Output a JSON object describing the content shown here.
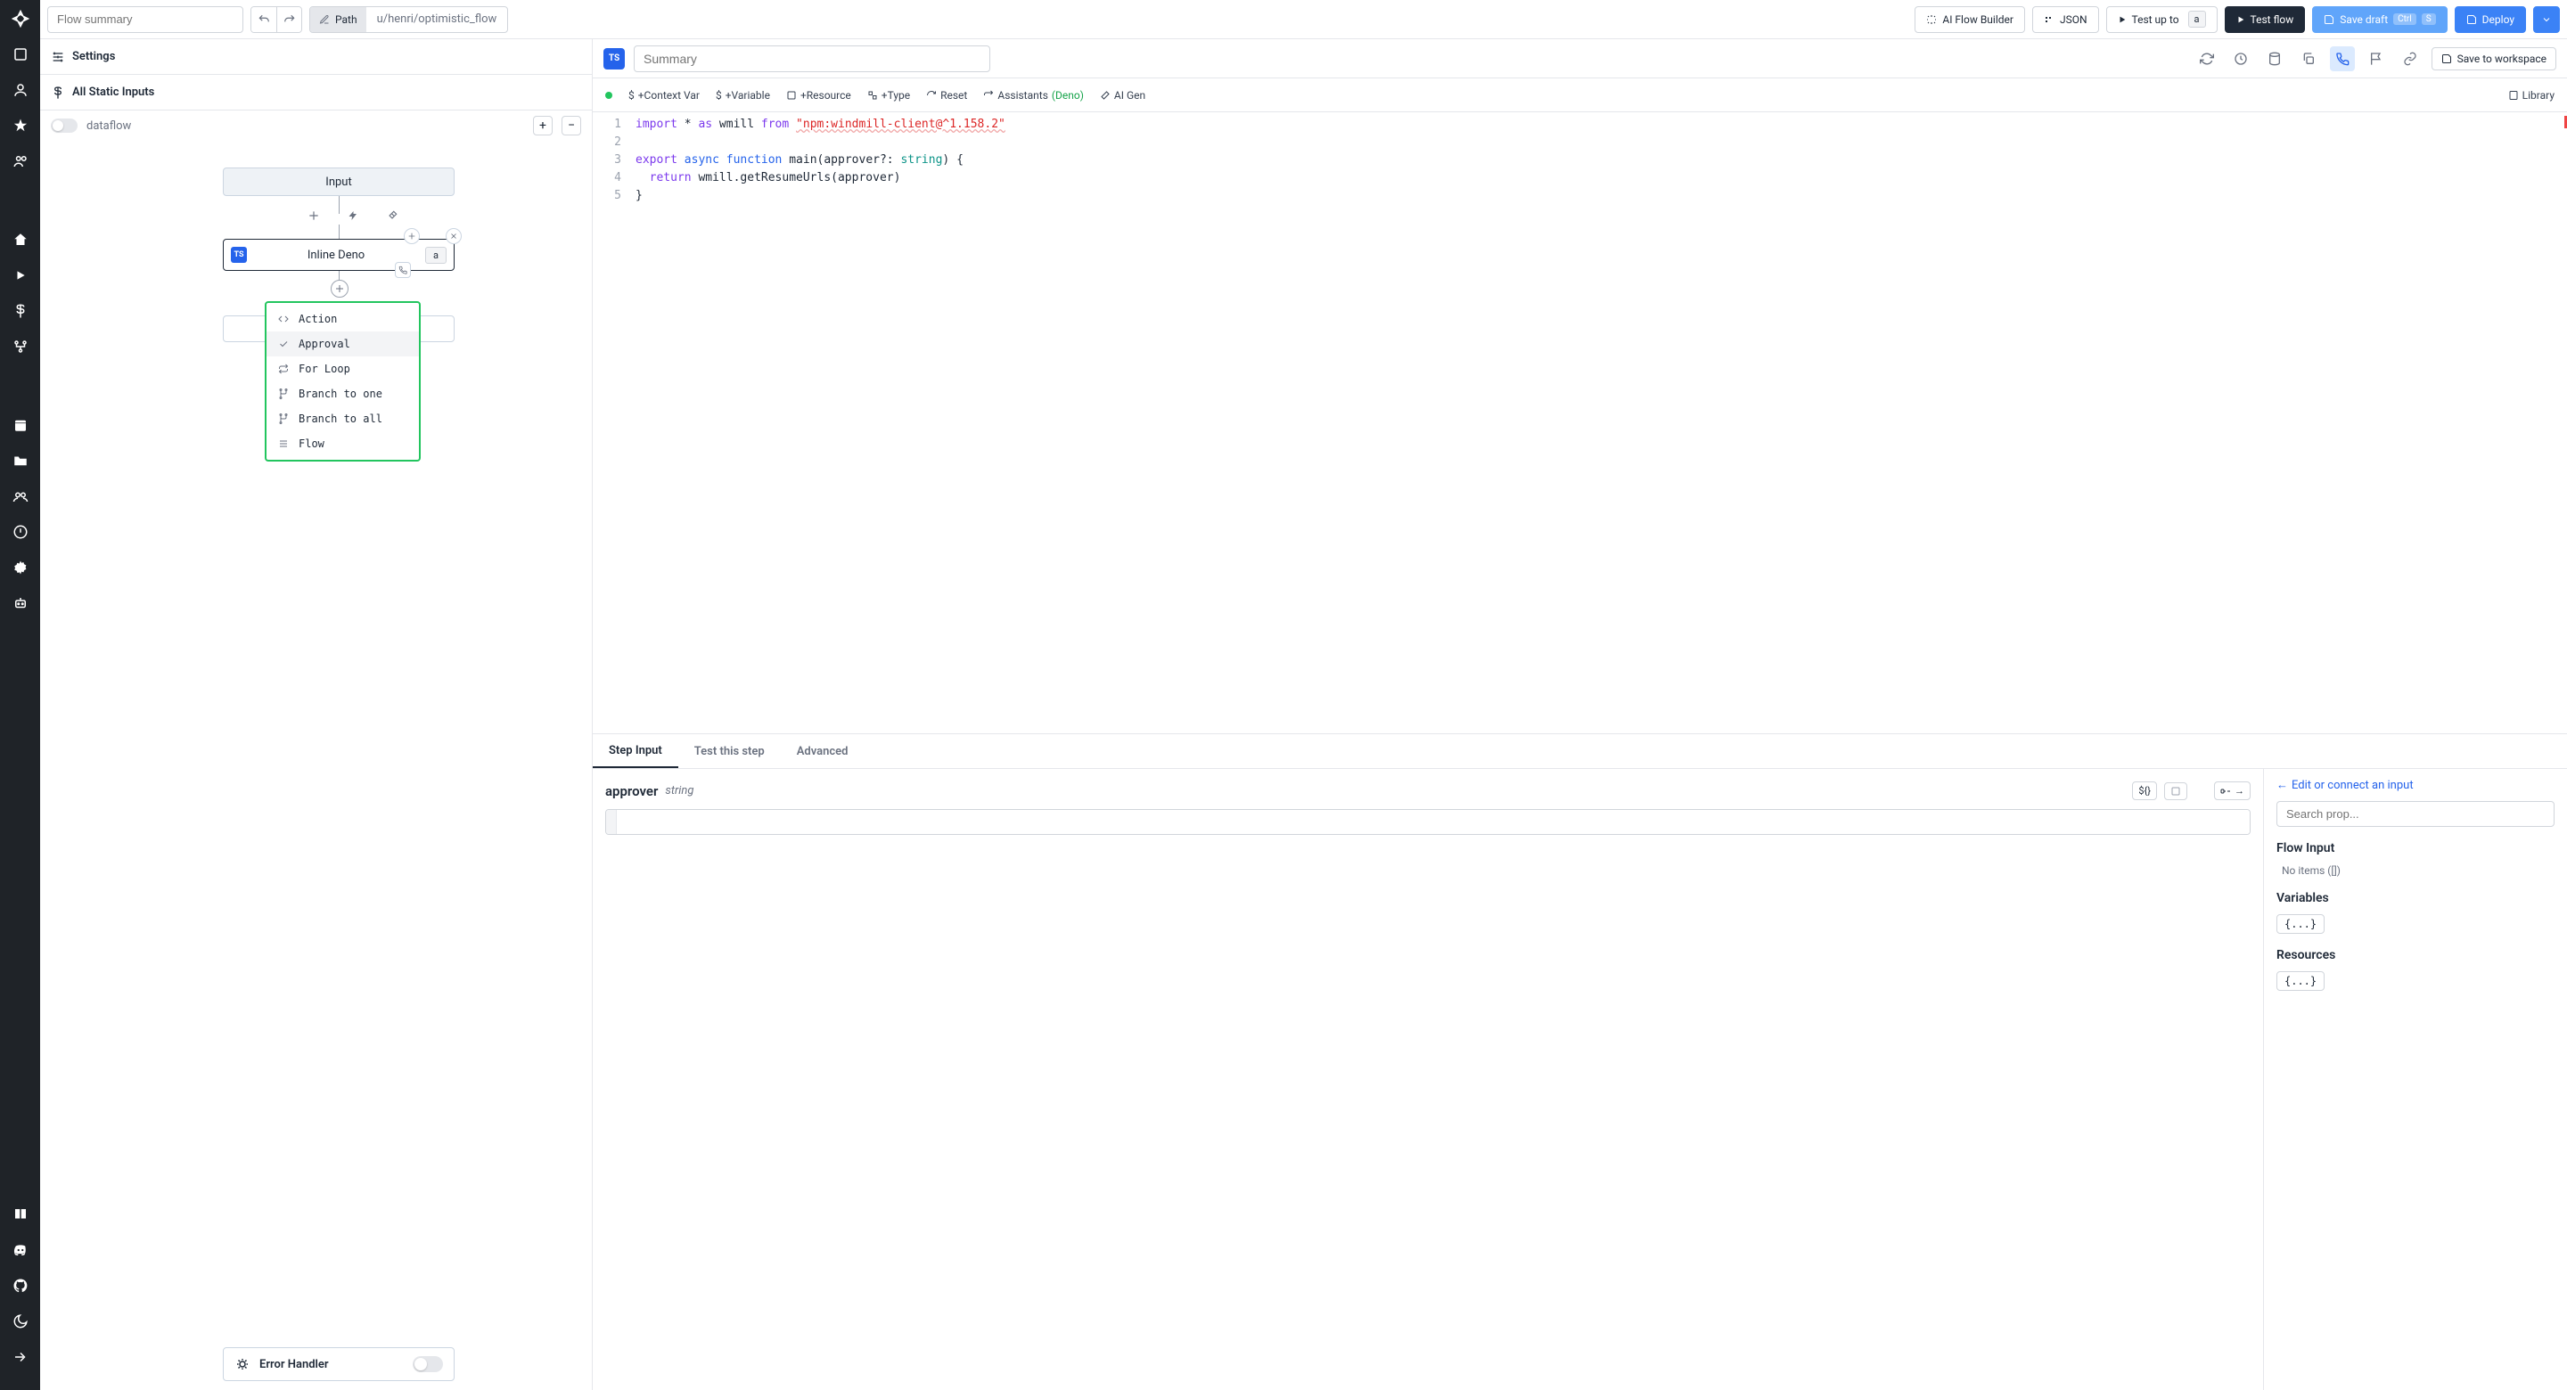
{
  "topbar": {
    "flow_summary_placeholder": "Flow summary",
    "path_label": "Path",
    "path_value": "u/henri/optimistic_flow",
    "ai_builder": "AI Flow Builder",
    "json": "JSON",
    "test_up_to": "Test up to",
    "test_up_to_id": "a",
    "test_flow": "Test flow",
    "save_draft": "Save draft",
    "save_kbd1": "Ctrl",
    "save_kbd2": "S",
    "deploy": "Deploy"
  },
  "left": {
    "settings": "Settings",
    "all_static": "All Static Inputs",
    "dataflow": "dataflow",
    "input_node": "Input",
    "deno_node": "Inline Deno",
    "deno_id": "a",
    "dropdown": {
      "action": "Action",
      "approval": "Approval",
      "forloop": "For Loop",
      "branch_one": "Branch to one",
      "branch_all": "Branch to all",
      "flow": "Flow"
    },
    "error_handler": "Error Handler"
  },
  "right": {
    "summary_placeholder": "Summary",
    "save_workspace": "Save to workspace",
    "context_var": "+Context Var",
    "variable": "+Variable",
    "resource": "+Resource",
    "type": "+Type",
    "reset": "Reset",
    "assistants": "Assistants",
    "assistants_paren": "(Deno)",
    "ai_gen": "AI Gen",
    "library": "Library"
  },
  "code": {
    "l1": "import * as wmill from \"npm:windmill-client@^1.158.2\"",
    "l3": "export async function main(approver?: string) {",
    "l4": "  return wmill.getResumeUrls(approver)",
    "l5": "}"
  },
  "tabs": {
    "step_input": "Step Input",
    "test_step": "Test this step",
    "advanced": "Advanced"
  },
  "step": {
    "param_name": "approver",
    "param_type": "string",
    "dollar": "${}",
    "edit_link": "Edit or connect an input",
    "search_placeholder": "Search prop...",
    "flow_input": "Flow Input",
    "no_items": "No items ([])",
    "variables": "Variables",
    "resources": "Resources",
    "brace": "{...}"
  }
}
